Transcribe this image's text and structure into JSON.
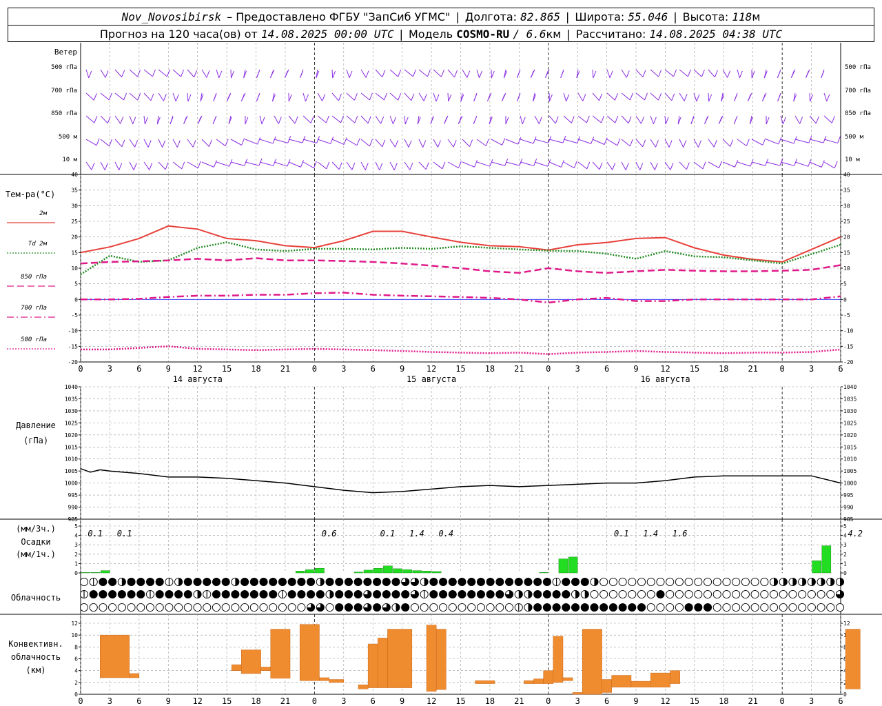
{
  "header": {
    "station": "Nov_Novosibirsk",
    "provider": "– Предоставлено ФГБУ \"ЗапСиб УГМС\"",
    "lon_label": "Долгота:",
    "lon_value": "82.865",
    "lat_label": "Широта:",
    "lat_value": "55.046",
    "alt_label": "Высота:",
    "alt_value": "118",
    "alt_unit": "м",
    "forecast_prefix": "Прогноз на 120 часа(ов) от",
    "forecast_start": "14.08.2025 00:00 UTC",
    "model_label": "Модель",
    "model_name": "COSMO-RU",
    "model_res": "/ 6.6",
    "model_res_unit": "км",
    "calc_label": "Рассчитано:",
    "calc_time": "14.08.2025 04:38 UTC"
  },
  "chart_data": [
    {
      "type": "wind-barbs",
      "title": "Ветер",
      "levels": [
        "500 гПа",
        "700 гПа",
        "850 гПа",
        "500 м",
        "10 м"
      ],
      "colors": {
        "barb": "#8a2be2"
      }
    },
    {
      "type": "line",
      "title": "Тем-ра(°C)",
      "ylim": [
        -20,
        40
      ],
      "yticks": [
        -20,
        -15,
        -10,
        -5,
        0,
        5,
        10,
        15,
        20,
        25,
        30,
        35,
        40
      ],
      "xticks": [
        "0",
        "3",
        "6",
        "9",
        "12",
        "15",
        "18",
        "21",
        "0",
        "3",
        "6",
        "9",
        "12",
        "15",
        "18",
        "21",
        "0",
        "3",
        "6",
        "9",
        "12",
        "15",
        "18",
        "21",
        "0",
        "3",
        "6"
      ],
      "date_labels": [
        "14 августа",
        "15 августа",
        "16 августа"
      ],
      "x_hours": [
        0,
        3,
        6,
        9,
        12,
        15,
        18,
        21,
        24,
        27,
        30,
        33,
        36,
        39,
        42,
        45,
        48,
        51,
        54,
        57,
        60,
        63,
        66,
        69,
        72,
        75,
        78
      ],
      "series": [
        {
          "name": "2м",
          "color": "#e8403a",
          "style": "solid",
          "values": [
            15.0,
            16.8,
            19.5,
            23.5,
            22.5,
            19.5,
            18.8,
            17.2,
            16.6,
            18.8,
            21.8,
            21.8,
            20.0,
            18.3,
            17.2,
            16.9,
            15.8,
            17.5,
            18.2,
            19.5,
            19.8,
            16.5,
            14.2,
            12.8,
            12.0,
            16.0,
            20.0
          ]
        },
        {
          "name": "Td 2м",
          "color": "#228b22",
          "style": "dotted",
          "values": [
            8.0,
            14.0,
            12.0,
            12.5,
            16.5,
            18.3,
            16.0,
            15.5,
            16.2,
            16.2,
            16.0,
            16.5,
            16.2,
            17.0,
            16.5,
            16.0,
            15.6,
            15.5,
            14.6,
            13.0,
            15.5,
            13.8,
            13.5,
            12.5,
            11.5,
            14.5,
            17.5
          ]
        },
        {
          "name": "850 гПа",
          "color": "#e0198a",
          "style": "dashed",
          "values": [
            11.5,
            12.0,
            12.2,
            12.5,
            13.0,
            12.5,
            13.2,
            12.5,
            12.5,
            12.3,
            12.0,
            11.5,
            10.8,
            10.0,
            9.0,
            8.5,
            10.0,
            9.0,
            8.5,
            9.0,
            9.5,
            9.2,
            9.0,
            9.0,
            9.2,
            9.5,
            11.0
          ]
        },
        {
          "name": "700 гПа",
          "color": "#e0198a",
          "style": "dashdot",
          "values": [
            0.0,
            0.0,
            0.2,
            0.8,
            1.2,
            1.2,
            1.5,
            1.5,
            2.0,
            2.2,
            1.5,
            1.2,
            1.0,
            0.8,
            0.5,
            0.0,
            -1.0,
            0.0,
            0.5,
            -0.5,
            -0.5,
            0.0,
            0.0,
            0.0,
            0.0,
            0.0,
            1.0
          ]
        },
        {
          "name": "500 гПа",
          "color": "#e0198a",
          "style": "dotted",
          "values": [
            -16.0,
            -16.0,
            -15.5,
            -15.0,
            -15.8,
            -16.0,
            -16.2,
            -16.0,
            -15.8,
            -16.0,
            -16.2,
            -16.5,
            -16.8,
            -17.0,
            -17.2,
            -17.0,
            -17.5,
            -17.0,
            -16.8,
            -16.5,
            -16.8,
            -17.0,
            -17.2,
            -17.0,
            -17.0,
            -16.8,
            -16.0
          ]
        }
      ]
    },
    {
      "type": "line",
      "title": "Давление",
      "ylabel": "(гПа)",
      "ylim": [
        985,
        1040
      ],
      "yticks": [
        985,
        990,
        995,
        1000,
        1005,
        1010,
        1015,
        1020,
        1025,
        1030,
        1035,
        1040
      ],
      "x_hours": [
        0,
        1,
        2,
        3,
        6,
        9,
        12,
        15,
        18,
        21,
        24,
        27,
        30,
        33,
        36,
        39,
        42,
        45,
        48,
        51,
        54,
        57,
        60,
        63,
        66,
        69,
        72,
        75,
        78
      ],
      "series": [
        {
          "name": "pressure",
          "color": "#000000",
          "values": [
            1006,
            1004.5,
            1005.5,
            1005,
            1004,
            1002.5,
            1002.5,
            1002,
            1001,
            1000,
            998.5,
            997,
            996,
            996.5,
            997.5,
            998.5,
            999,
            998.5,
            999,
            999.5,
            1000,
            1000,
            1001,
            1002.5,
            1003,
            1003,
            1003,
            1003,
            1000
          ]
        }
      ]
    },
    {
      "type": "bar",
      "title": "Осадки",
      "ylabel_top": "(мм/3ч.)",
      "ylabel": "(мм/1ч.)",
      "ylim": [
        0,
        5
      ],
      "yticks": [
        0,
        1,
        2,
        3,
        4,
        5
      ],
      "colors": {
        "bar": "#22dd22"
      },
      "totals": [
        {
          "hour": 1.5,
          "label": "0.1"
        },
        {
          "hour": 4.5,
          "label": "0.1"
        },
        {
          "hour": 25.5,
          "label": "0.6"
        },
        {
          "hour": 31.5,
          "label": "0.1"
        },
        {
          "hour": 34.5,
          "label": "1.4"
        },
        {
          "hour": 37.5,
          "label": "0.4"
        },
        {
          "hour": 55.5,
          "label": "0.1"
        },
        {
          "hour": 58.5,
          "label": "1.4"
        },
        {
          "hour": 61.5,
          "label": "1.6"
        },
        {
          "hour": 79.5,
          "label": "4.2"
        }
      ],
      "hours": [
        1,
        2,
        3,
        23,
        24,
        25,
        29,
        30,
        31,
        32,
        33,
        34,
        35,
        36,
        37,
        48,
        50,
        51,
        76,
        77
      ],
      "values": [
        0.05,
        0.05,
        0.25,
        0.2,
        0.35,
        0.5,
        0.1,
        0.3,
        0.5,
        0.75,
        0.45,
        0.35,
        0.25,
        0.2,
        0.15,
        0.05,
        1.5,
        1.7,
        1.3,
        2.9
      ]
    },
    {
      "type": "icon-grid",
      "title": "Облачность",
      "rows": [
        "01442444412444442444444442444444443324444444444444144420000000000000000002222222224",
        "14444441444421444444414444244434444314444444432244442200000004000000000000000000332444",
        "0000000000000000000000003304443432400000000000124444444444440000444000000000000000334"
      ]
    },
    {
      "type": "bar",
      "title": "Конвективн. облачность",
      "ylabel": "(км)",
      "ylim": [
        0,
        12
      ],
      "yticks": [
        0,
        2,
        4,
        6,
        8,
        10,
        12
      ],
      "colors": {
        "bar": "#f08c30"
      },
      "bars": [
        {
          "start": 2,
          "end": 5,
          "base": 2.8,
          "top": 10
        },
        {
          "start": 5,
          "end": 6,
          "base": 2.8,
          "top": 3.5
        },
        {
          "start": 15.5,
          "end": 16.5,
          "base": 4,
          "top": 5
        },
        {
          "start": 16.5,
          "end": 18.5,
          "base": 3.5,
          "top": 7.5
        },
        {
          "start": 18.5,
          "end": 19.5,
          "base": 4,
          "top": 4.6
        },
        {
          "start": 19.5,
          "end": 21.5,
          "base": 2.7,
          "top": 11
        },
        {
          "start": 22.5,
          "end": 24.5,
          "base": 2.3,
          "top": 11.8
        },
        {
          "start": 24.5,
          "end": 25.5,
          "base": 2.3,
          "top": 2.8
        },
        {
          "start": 25.5,
          "end": 27,
          "base": 2,
          "top": 2.5
        },
        {
          "start": 28.5,
          "end": 29.5,
          "base": 0.9,
          "top": 1.6
        },
        {
          "start": 29.5,
          "end": 30.5,
          "base": 1.1,
          "top": 8.5
        },
        {
          "start": 30.5,
          "end": 31.5,
          "base": 1.1,
          "top": 9.5
        },
        {
          "start": 31.5,
          "end": 34,
          "base": 1.1,
          "top": 11
        },
        {
          "start": 35.5,
          "end": 36.5,
          "base": 0.5,
          "top": 11.7
        },
        {
          "start": 36.5,
          "end": 37.5,
          "base": 0.8,
          "top": 11
        },
        {
          "start": 40.5,
          "end": 42.5,
          "base": 1.8,
          "top": 2.3
        },
        {
          "start": 45.5,
          "end": 46.5,
          "base": 1.8,
          "top": 2.3
        },
        {
          "start": 46.5,
          "end": 47.5,
          "base": 1.8,
          "top": 2.6
        },
        {
          "start": 47.5,
          "end": 48.5,
          "base": 1.8,
          "top": 4
        },
        {
          "start": 48.5,
          "end": 49.5,
          "base": 2,
          "top": 9.8
        },
        {
          "start": 49.5,
          "end": 50.5,
          "base": 2.3,
          "top": 2.8
        },
        {
          "start": 50.5,
          "end": 51.5,
          "base": 0,
          "top": 0.3
        },
        {
          "start": 51.5,
          "end": 53.5,
          "base": 0,
          "top": 11
        },
        {
          "start": 53.5,
          "end": 54.5,
          "base": 0.3,
          "top": 2.5
        },
        {
          "start": 54.5,
          "end": 56.5,
          "base": 1.2,
          "top": 3.2
        },
        {
          "start": 56.5,
          "end": 58.5,
          "base": 1.2,
          "top": 2.2
        },
        {
          "start": 58.5,
          "end": 60.5,
          "base": 1.2,
          "top": 3.6
        },
        {
          "start": 60.5,
          "end": 61.5,
          "base": 1.8,
          "top": 4
        },
        {
          "start": 78.5,
          "end": 80,
          "base": 0.9,
          "top": 11
        }
      ]
    }
  ]
}
